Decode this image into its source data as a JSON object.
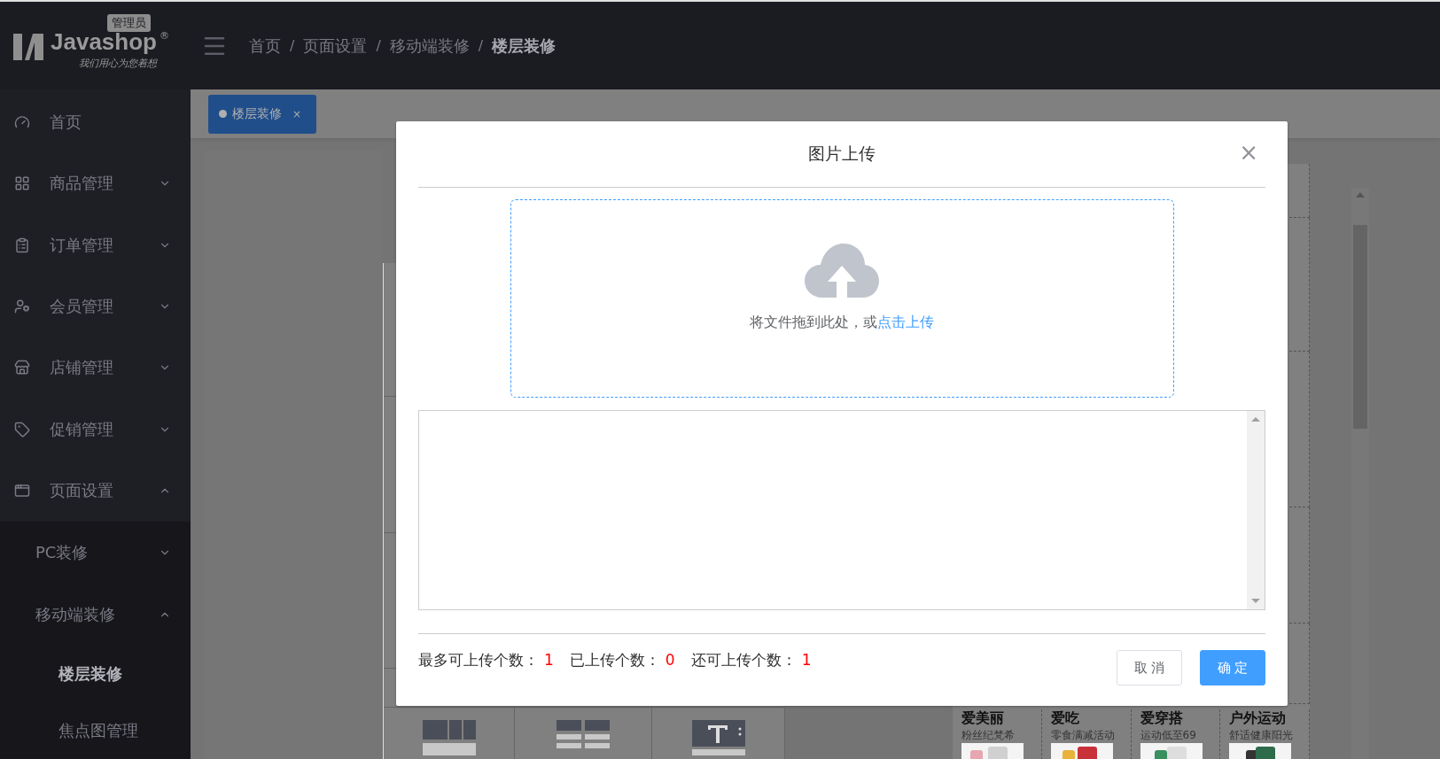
{
  "header": {
    "logo": {
      "name": "Javashop",
      "mark": "®",
      "badge": "管理员",
      "tagline": "我们用心为您着想"
    },
    "breadcrumb": {
      "separator": "/",
      "items": [
        {
          "label": "首页",
          "current": false
        },
        {
          "label": "页面设置",
          "current": false
        },
        {
          "label": "移动端装修",
          "current": false
        },
        {
          "label": "楼层装修",
          "current": true
        }
      ]
    }
  },
  "sidebar": {
    "items": [
      {
        "label": "首页"
      },
      {
        "label": "商品管理",
        "expanded": false
      },
      {
        "label": "订单管理",
        "expanded": false
      },
      {
        "label": "会员管理",
        "expanded": false
      },
      {
        "label": "店铺管理",
        "expanded": false
      },
      {
        "label": "促销管理",
        "expanded": false
      },
      {
        "label": "页面设置",
        "expanded": true,
        "children": [
          {
            "label": "PC装修",
            "expanded": false
          },
          {
            "label": "移动端装修",
            "expanded": true,
            "children": [
              {
                "label": "楼层装修",
                "selected": true
              },
              {
                "label": "焦点图管理",
                "selected": false
              }
            ]
          }
        ]
      }
    ]
  },
  "tabs": [
    {
      "label": "楼层装修",
      "close": "×",
      "selected": true
    }
  ],
  "floor": [
    {
      "title": "爱美丽",
      "subtitle": "粉丝纪梵希"
    },
    {
      "title": "爱吃",
      "subtitle": "零食满减活动"
    },
    {
      "title": "爱穿搭",
      "subtitle": "运动低至69"
    },
    {
      "title": "户外运动",
      "subtitle": "舒适健康阳光"
    }
  ],
  "dialog": {
    "title": "图片上传",
    "close": "×",
    "upload": {
      "hint": "将文件拖到此处，或",
      "link": "点击上传"
    },
    "counts": [
      {
        "label": "最多可上传个数：",
        "value": "1"
      },
      {
        "label": "已上传个数：",
        "value": "0"
      },
      {
        "label": "还可上传个数：",
        "value": "1"
      }
    ],
    "buttons": [
      {
        "label": "取 消",
        "kind": "default"
      },
      {
        "label": "确 定",
        "kind": "primary"
      }
    ]
  }
}
